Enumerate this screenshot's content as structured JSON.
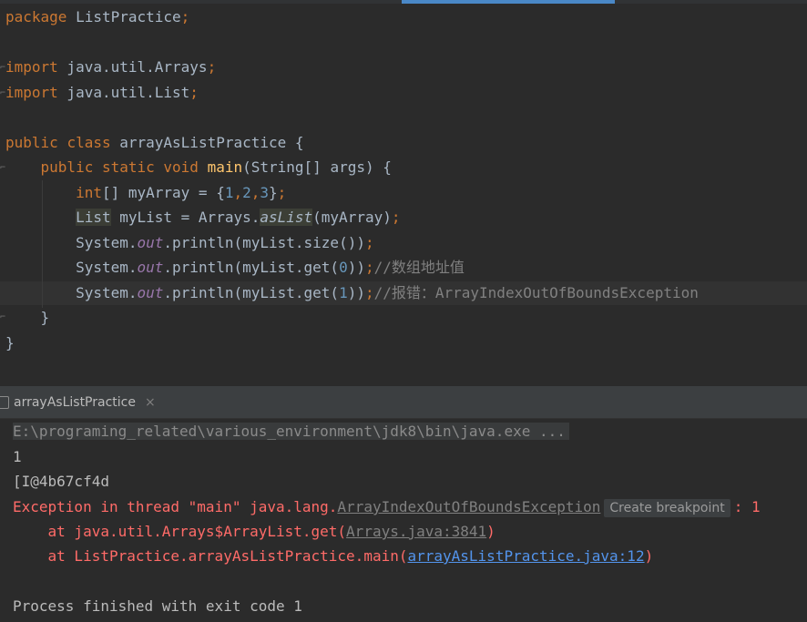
{
  "editor": {
    "line_package_kw": "package",
    "line_package_name": " ListPractice",
    "semicolon": ";",
    "import_kw": "import",
    "import1": " java.util.Arrays",
    "import2": " java.util.List",
    "public_kw": "public",
    "class_kw": "class",
    "class_name": " arrayAsListPractice {",
    "static_kw": "static",
    "void_kw": "void",
    "main_fn": "main",
    "main_params": "(String[] args) {",
    "int_kw": "int",
    "arr_decl": "[] myArray = {",
    "n1": "1",
    "n2": "2",
    "n3": "3",
    "arr_close": "}",
    "list_type": "List",
    "list_decl": " myList = Arrays.",
    "aslist_fn": "asList",
    "aslist_args": "(myArray)",
    "sysout_prefix": "System.",
    "out_field": "out",
    "println_size": ".println(myList.size())",
    "println_get_open": ".println(myList.get(",
    "get0": "0",
    "get1": "1",
    "println_get_close": "))",
    "comment1": "//数组地址值",
    "comment2": "//报错：ArrayIndexOutOfBoundsException",
    "close_brace": "}"
  },
  "run": {
    "tab_label": "arrayAsListPractice",
    "close_glyph": "×",
    "cmdline": "E:\\programing_related\\various_environment\\jdk8\\bin\\java.exe ...",
    "out1": "1",
    "out2": "[I@4b67cf4d",
    "exception_prefix": "Exception in thread \"main\" java.lang.",
    "exception_class": "ArrayIndexOutOfBoundsException",
    "create_breakpoint": "Create breakpoint",
    "exception_suffix": ": 1",
    "trace1_prefix": "    at java.util.Arrays$ArrayList.get(",
    "trace1_link": "Arrays.java:3841",
    "trace1_suffix": ")",
    "trace2_prefix": "    at ListPractice.arrayAsListPractice.main(",
    "trace2_link": "arrayAsListPractice.java:12",
    "trace2_suffix": ")",
    "exit": "Process finished with exit code 1"
  },
  "colors": {
    "background": "#2b2b2b",
    "keyword": "#cc7832",
    "number": "#6897bb",
    "method": "#ffc66d",
    "static_field": "#9876aa",
    "comment": "#808080",
    "error": "#ff6b68",
    "link": "#5394ec"
  }
}
